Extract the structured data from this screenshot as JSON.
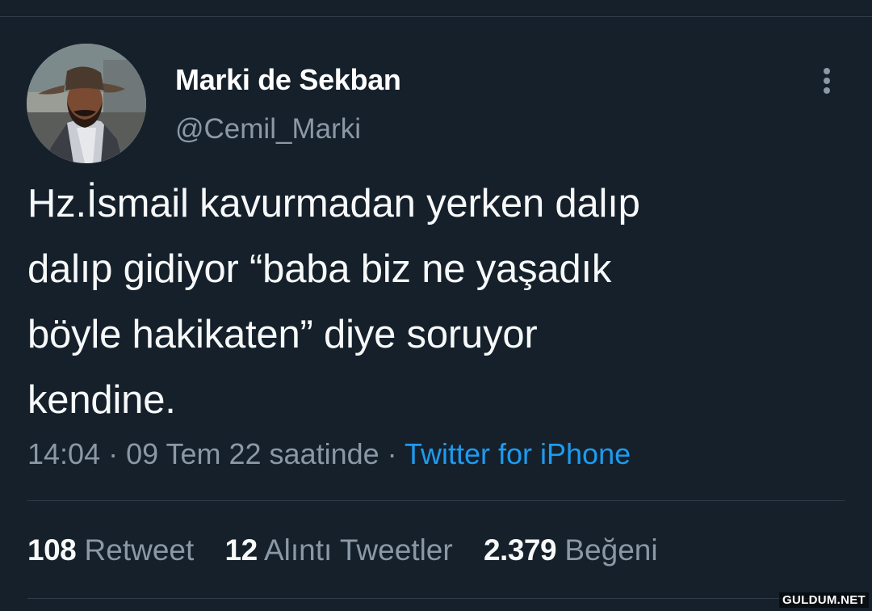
{
  "author": {
    "display_name": "Marki de Sekban",
    "handle": "@Cemil_Marki",
    "avatar_icon": "user-avatar"
  },
  "tweet": {
    "text": "Hz.İsmail kavurmadan yerken dalıp\ndalıp gidiyor “baba biz ne yaşadık\nböyle hakikaten” diye soruyor\nkendine."
  },
  "meta": {
    "time": "14:04",
    "separator": " · ",
    "date": "09 Tem 22 saatinde",
    "source": "Twitter for iPhone"
  },
  "stats": {
    "retweets": {
      "count": "108",
      "label": "Retweet"
    },
    "quotes": {
      "count": "12",
      "label": "Alıntı Tweetler"
    },
    "likes": {
      "count": "2.379",
      "label": "Beğeni"
    }
  },
  "watermark": "GULDUM.NET",
  "colors": {
    "background": "#15202b",
    "secondary_text": "#8b98a5",
    "link": "#1d9bf0"
  }
}
